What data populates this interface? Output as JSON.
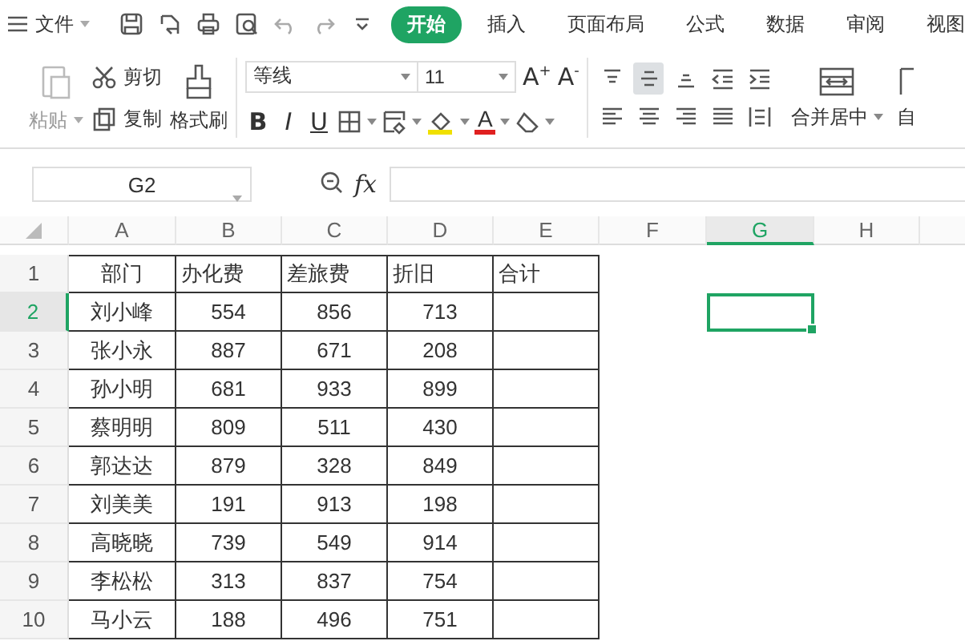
{
  "menu_bar": {
    "file_menu": "文件",
    "tabs": [
      {
        "label": "开始",
        "selected": true
      },
      {
        "label": "插入",
        "selected": false
      },
      {
        "label": "页面布局",
        "selected": false
      },
      {
        "label": "公式",
        "selected": false
      },
      {
        "label": "数据",
        "selected": false
      },
      {
        "label": "审阅",
        "selected": false
      },
      {
        "label": "视图",
        "selected": false
      }
    ]
  },
  "ribbon": {
    "clipboard": {
      "paste": "粘贴",
      "cut": "剪切",
      "copy": "复制",
      "format_painter": "格式刷"
    },
    "font": {
      "name": "等线",
      "size": "11",
      "grow": "A",
      "grow_sign": "+",
      "shrink": "A",
      "shrink_sign": "-",
      "bold": "B",
      "italic": "I",
      "underline": "U",
      "font_color": "A"
    },
    "alignment": [
      {
        "kind": "top",
        "selected": false
      },
      {
        "kind": "middle",
        "selected": true
      },
      {
        "kind": "bottom",
        "selected": false
      },
      {
        "kind": "outdent",
        "selected": false
      },
      {
        "kind": "indent",
        "selected": false
      },
      {
        "kind": "left",
        "selected": false
      },
      {
        "kind": "center",
        "selected": false
      },
      {
        "kind": "right",
        "selected": false
      },
      {
        "kind": "justify",
        "selected": false
      },
      {
        "kind": "distributed",
        "selected": false
      }
    ],
    "merge": "合并居中",
    "wrap": "自"
  },
  "name_box": "G2",
  "formula_label": "fx",
  "sheet": {
    "columns": [
      {
        "label": "A",
        "selected": false
      },
      {
        "label": "B",
        "selected": false
      },
      {
        "label": "C",
        "selected": false
      },
      {
        "label": "D",
        "selected": false
      },
      {
        "label": "E",
        "selected": false
      },
      {
        "label": "F",
        "selected": false
      },
      {
        "label": "G",
        "selected": true
      },
      {
        "label": "H",
        "selected": false
      }
    ],
    "rows": [
      {
        "number": "1",
        "selected": false,
        "cells": [
          "部门",
          "办化费",
          "差旅费",
          "折旧",
          "合计"
        ]
      },
      {
        "number": "2",
        "selected": true,
        "cells": [
          "刘小峰",
          "554",
          "856",
          "713"
        ]
      },
      {
        "number": "3",
        "selected": false,
        "cells": [
          "张小永",
          "887",
          "671",
          "208"
        ]
      },
      {
        "number": "4",
        "selected": false,
        "cells": [
          "孙小明",
          "681",
          "933",
          "899"
        ]
      },
      {
        "number": "5",
        "selected": false,
        "cells": [
          "蔡明明",
          "809",
          "511",
          "430"
        ]
      },
      {
        "number": "6",
        "selected": false,
        "cells": [
          "郭达达",
          "879",
          "328",
          "849"
        ]
      },
      {
        "number": "7",
        "selected": false,
        "cells": [
          "刘美美",
          "191",
          "913",
          "198"
        ]
      },
      {
        "number": "8",
        "selected": false,
        "cells": [
          "高晓晓",
          "739",
          "549",
          "914"
        ]
      },
      {
        "number": "9",
        "selected": false,
        "cells": [
          "李松松",
          "313",
          "837",
          "754"
        ]
      },
      {
        "number": "10",
        "selected": false,
        "cells": [
          "马小云",
          "188",
          "496",
          "751"
        ]
      }
    ]
  }
}
